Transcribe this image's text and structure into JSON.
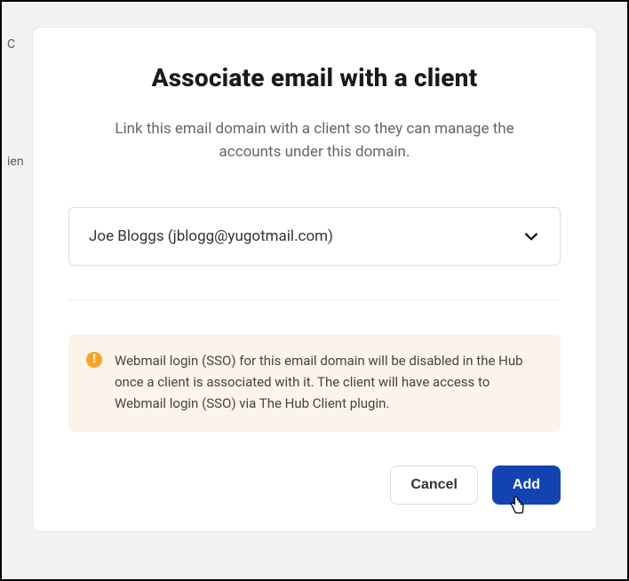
{
  "background": {
    "text1": "C",
    "text2": "ien"
  },
  "modal": {
    "title": "Associate email with a client",
    "description": "Link this email domain with a client so they can manage the accounts under this domain.",
    "select": {
      "value": "Joe Bloggs (jblogg@yugotmail.com)"
    },
    "alert": {
      "message": "Webmail login (SSO) for this email domain will be disabled in the Hub once a client is associated with it. The client will have access to Webmail login (SSO) via The Hub Client plugin."
    },
    "actions": {
      "cancel": "Cancel",
      "add": "Add"
    }
  }
}
